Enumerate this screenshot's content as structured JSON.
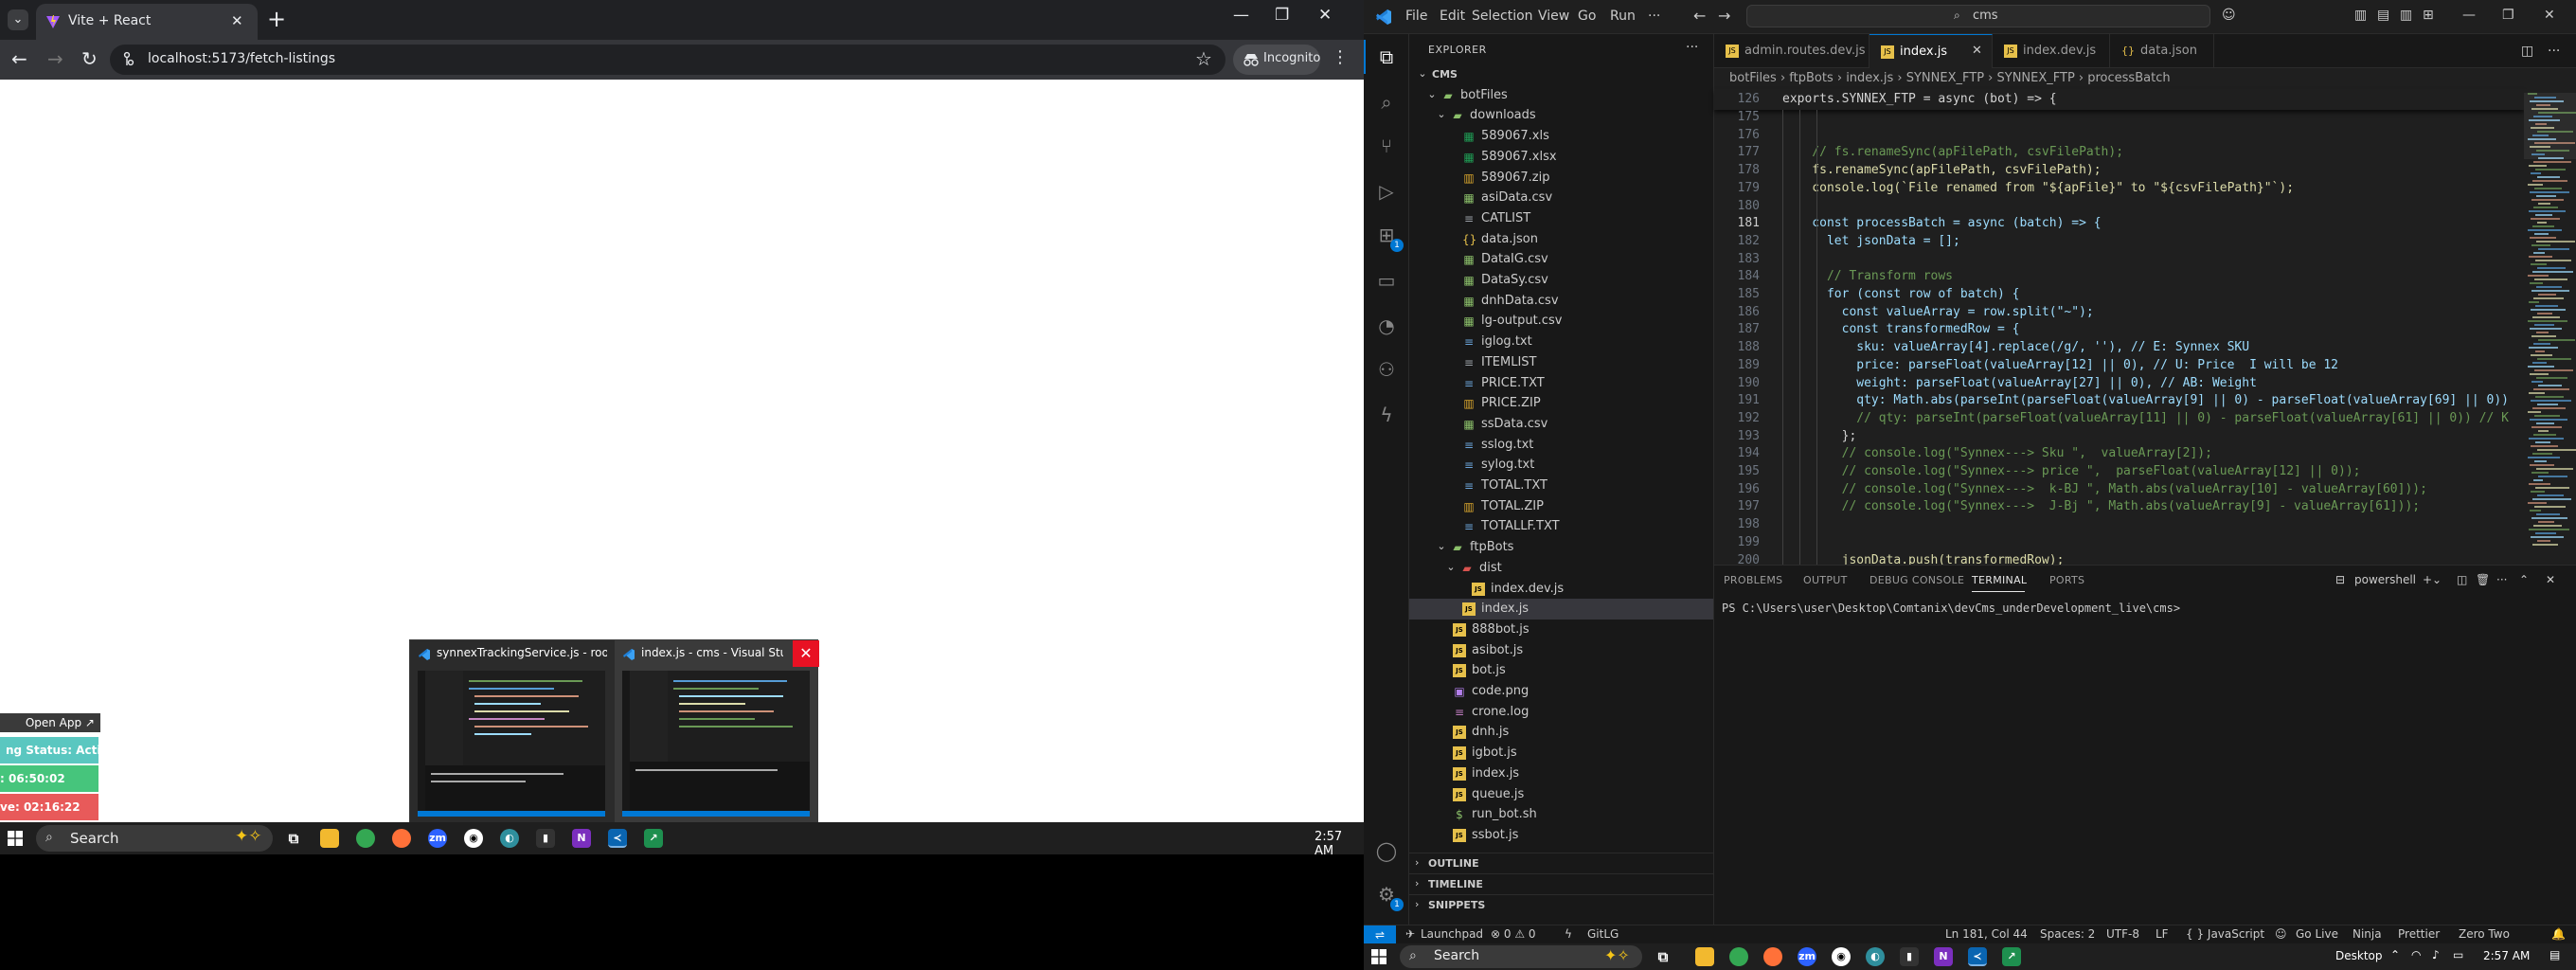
{
  "chrome": {
    "tab_title": "Vite + React",
    "url": "localhost:5173/fetch-listings",
    "incognito_label": "Incognito",
    "floating_panel": {
      "open_app": "Open App ↗",
      "status": "ng Status: Active",
      "time1": ": 06:50:02",
      "time2": "ve: 02:16:22"
    },
    "previews": [
      {
        "title": "synnexTrackingService.js - root ..."
      },
      {
        "title": "index.js - cms - Visual Stu..."
      }
    ]
  },
  "taskbar_left": {
    "search_placeholder": "Search",
    "clock": "2:57 AM"
  },
  "vscode": {
    "menu": [
      "File",
      "Edit",
      "Selection",
      "View",
      "Go",
      "Run"
    ],
    "command_center": "cms",
    "explorer": {
      "title": "EXPLORER",
      "tree": [
        {
          "label": "CMS",
          "depth": 0,
          "type": "root"
        },
        {
          "label": "botFiles",
          "depth": 1,
          "type": "folder-open"
        },
        {
          "label": "downloads",
          "depth": 2,
          "type": "folder-open"
        },
        {
          "label": "589067.xls",
          "depth": 3,
          "type": "xls"
        },
        {
          "label": "589067.xlsx",
          "depth": 3,
          "type": "xls"
        },
        {
          "label": "589067.zip",
          "depth": 3,
          "type": "zip"
        },
        {
          "label": "asiData.csv",
          "depth": 3,
          "type": "csv"
        },
        {
          "label": "CATLIST",
          "depth": 3,
          "type": "file"
        },
        {
          "label": "data.json",
          "depth": 3,
          "type": "json"
        },
        {
          "label": "DataIG.csv",
          "depth": 3,
          "type": "csv"
        },
        {
          "label": "DataSy.csv",
          "depth": 3,
          "type": "csv"
        },
        {
          "label": "dnhData.csv",
          "depth": 3,
          "type": "csv"
        },
        {
          "label": "lg-output.csv",
          "depth": 3,
          "type": "csv"
        },
        {
          "label": "iglog.txt",
          "depth": 3,
          "type": "txt"
        },
        {
          "label": "ITEMLIST",
          "depth": 3,
          "type": "file"
        },
        {
          "label": "PRICE.TXT",
          "depth": 3,
          "type": "txt"
        },
        {
          "label": "PRICE.ZIP",
          "depth": 3,
          "type": "zip"
        },
        {
          "label": "ssData.csv",
          "depth": 3,
          "type": "csv"
        },
        {
          "label": "sslog.txt",
          "depth": 3,
          "type": "txt"
        },
        {
          "label": "sylog.txt",
          "depth": 3,
          "type": "txt"
        },
        {
          "label": "TOTAL.TXT",
          "depth": 3,
          "type": "txt"
        },
        {
          "label": "TOTAL.ZIP",
          "depth": 3,
          "type": "zip"
        },
        {
          "label": "TOTALLF.TXT",
          "depth": 3,
          "type": "txt"
        },
        {
          "label": "ftpBots",
          "depth": 2,
          "type": "folder-open"
        },
        {
          "label": "dist",
          "depth": 3,
          "type": "folder-red"
        },
        {
          "label": "index.dev.js",
          "depth": 4,
          "type": "js"
        },
        {
          "label": "index.js",
          "depth": 3,
          "type": "js",
          "selected": true
        },
        {
          "label": "888bot.js",
          "depth": 2,
          "type": "js"
        },
        {
          "label": "asibot.js",
          "depth": 2,
          "type": "js"
        },
        {
          "label": "bot.js",
          "depth": 2,
          "type": "js"
        },
        {
          "label": "code.png",
          "depth": 2,
          "type": "img"
        },
        {
          "label": "crone.log",
          "depth": 2,
          "type": "log"
        },
        {
          "label": "dnh.js",
          "depth": 2,
          "type": "js"
        },
        {
          "label": "igbot.js",
          "depth": 2,
          "type": "js"
        },
        {
          "label": "index.js",
          "depth": 2,
          "type": "js"
        },
        {
          "label": "queue.js",
          "depth": 2,
          "type": "js"
        },
        {
          "label": "run_bot.sh",
          "depth": 2,
          "type": "sh"
        },
        {
          "label": "ssbot.js",
          "depth": 2,
          "type": "js"
        }
      ],
      "sections": [
        "OUTLINE",
        "TIMELINE",
        "SNIPPETS"
      ]
    },
    "tabs": [
      {
        "label": "admin.routes.dev.js",
        "icon": "js"
      },
      {
        "label": "index.js",
        "icon": "js",
        "active": true
      },
      {
        "label": "index.dev.js",
        "icon": "js"
      },
      {
        "label": "data.json",
        "icon": "json"
      }
    ],
    "breadcrumb": "botFiles  ›  ftpBots  ›  index.js  ›  SYNNEX_FTP  ›  SYNNEX_FTP  ›  processBatch",
    "sticky": {
      "line": "126",
      "text": "exports.SYNNEX_FTP = async (bot) => {"
    },
    "code_lines": [
      {
        "n": "175",
        "t": ""
      },
      {
        "n": "176",
        "t": ""
      },
      {
        "n": "177",
        "t": "    // fs.renameSync(apFilePath, csvFilePath);"
      },
      {
        "n": "178",
        "t": "    fs.renameSync(apFilePath, csvFilePath);"
      },
      {
        "n": "179",
        "t": "    console.log(`File renamed from \"${apFile}\" to \"${csvFilePath}\"`);"
      },
      {
        "n": "180",
        "t": ""
      },
      {
        "n": "181",
        "t": "    const processBatch = async (batch) => {"
      },
      {
        "n": "182",
        "t": "      let jsonData = [];"
      },
      {
        "n": "183",
        "t": ""
      },
      {
        "n": "184",
        "t": "      // Transform rows"
      },
      {
        "n": "185",
        "t": "      for (const row of batch) {"
      },
      {
        "n": "186",
        "t": "        const valueArray = row.split(\"~\");"
      },
      {
        "n": "187",
        "t": "        const transformedRow = {"
      },
      {
        "n": "188",
        "t": "          sku: valueArray[4].replace(/g/, ''), // E: Synnex SKU"
      },
      {
        "n": "189",
        "t": "          price: parseFloat(valueArray[12] || 0), // U: Price  I will be 12"
      },
      {
        "n": "190",
        "t": "          weight: parseFloat(valueArray[27] || 0), // AB: Weight"
      },
      {
        "n": "191",
        "t": "          qty: Math.abs(parseInt(parseFloat(valueArray[9] || 0) - parseFloat(valueArray[69] || 0))"
      },
      {
        "n": "192",
        "t": "          // qty: parseInt(parseFloat(valueArray[11] || 0) - parseFloat(valueArray[61] || 0)) // K"
      },
      {
        "n": "193",
        "t": "        };"
      },
      {
        "n": "194",
        "t": "        // console.log(\"Synnex---> Sku \",  valueArray[2]);"
      },
      {
        "n": "195",
        "t": "        // console.log(\"Synnex---> price \",  parseFloat(valueArray[12] || 0));"
      },
      {
        "n": "196",
        "t": "        // console.log(\"Synnex--->  k-BJ \", Math.abs(valueArray[10] - valueArray[60]));"
      },
      {
        "n": "197",
        "t": "        // console.log(\"Synnex--->  J-Bj \", Math.abs(valueArray[9] - valueArray[61]));"
      },
      {
        "n": "198",
        "t": ""
      },
      {
        "n": "199",
        "t": ""
      },
      {
        "n": "200",
        "t": "        jsonData.push(transformedRow);"
      }
    ],
    "panel": {
      "tabs": [
        "PROBLEMS",
        "OUTPUT",
        "DEBUG CONSOLE",
        "TERMINAL",
        "PORTS"
      ],
      "active_tab": "TERMINAL",
      "shell": "powershell",
      "prompt": "PS C:\\Users\\user\\Desktop\\Comtanix\\devCms_underDevelopment_live\\cms>"
    },
    "status": {
      "launchpad": "Launchpad",
      "problems": "⊗ 0 ⚠ 0",
      "gitlg": "GitLG",
      "position": "Ln 181, Col 44",
      "spaces": "Spaces: 2",
      "encoding": "UTF-8",
      "eol": "LF",
      "language": "{ } JavaScript",
      "golive": "Go Live",
      "ninja": "Ninja",
      "prettier": "Prettier",
      "zero": "Zero Two"
    }
  },
  "taskbar_right": {
    "search_placeholder": "Search",
    "desktop_label": "Desktop",
    "clock": "2:57 AM"
  }
}
